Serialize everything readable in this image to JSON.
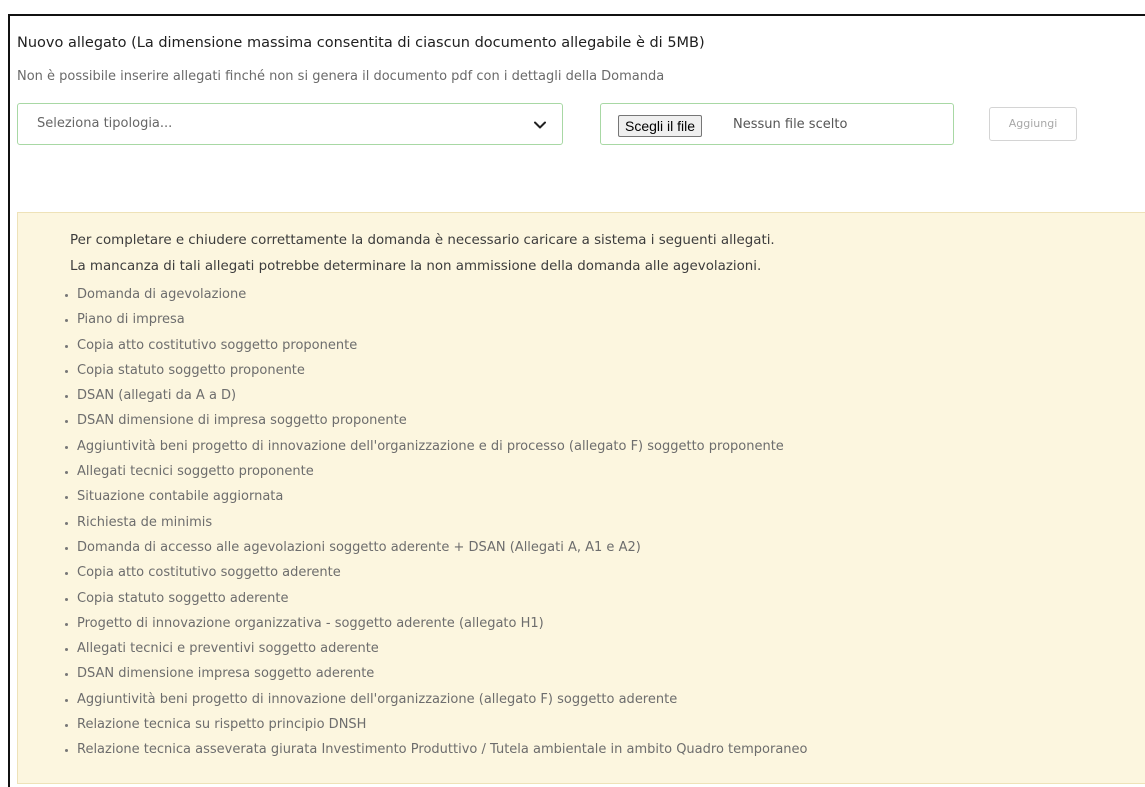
{
  "header": {
    "title": "Nuovo allegato (La dimensione massima consentita di ciascun documento allegabile è di 5MB)",
    "subtitle": "Non è possibile inserire allegati finché non si genera il documento pdf con i dettagli della Domanda"
  },
  "form": {
    "tipologia_select": {
      "selected": "Seleziona tipologia...",
      "icon": "chevron-down-icon"
    },
    "file_input": {
      "button_label": "Scegli il file",
      "status": "Nessun file scelto"
    },
    "add_button_label": "Aggiungi"
  },
  "notice": {
    "line1": "Per completare e chiudere correttamente la domanda è necessario caricare a sistema i seguenti allegati.",
    "line2": "La mancanza di tali allegati potrebbe determinare la non ammissione della domanda alle agevolazioni.",
    "items": [
      "Domanda di agevolazione",
      "Piano di impresa",
      "Copia atto costitutivo soggetto proponente",
      "Copia statuto soggetto proponente",
      "DSAN (allegati da A a D)",
      "DSAN dimensione di impresa soggetto proponente",
      "Aggiuntività beni progetto di innovazione dell'organizzazione e di processo (allegato F) soggetto proponente",
      "Allegati tecnici soggetto proponente",
      "Situazione contabile aggiornata",
      "Richiesta de minimis",
      "Domanda di accesso alle agevolazioni soggetto aderente + DSAN (Allegati A, A1 e A2)",
      "Copia atto costitutivo soggetto aderente",
      "Copia statuto soggetto aderente",
      "Progetto di innovazione organizzativa - soggetto aderente (allegato H1)",
      "Allegati tecnici e preventivi soggetto aderente",
      "DSAN dimensione impresa soggetto aderente",
      "Aggiuntività beni progetto di innovazione dell'organizzazione (allegato F) soggetto aderente",
      "Relazione tecnica su rispetto principio DNSH",
      "Relazione tecnica asseverata giurata Investimento Produttivo / Tutela ambientale in ambito Quadro temporaneo"
    ]
  },
  "colors": {
    "input_border": "#a8d8a4",
    "notice_background": "#fcf6df",
    "notice_border": "#eee2b8"
  }
}
